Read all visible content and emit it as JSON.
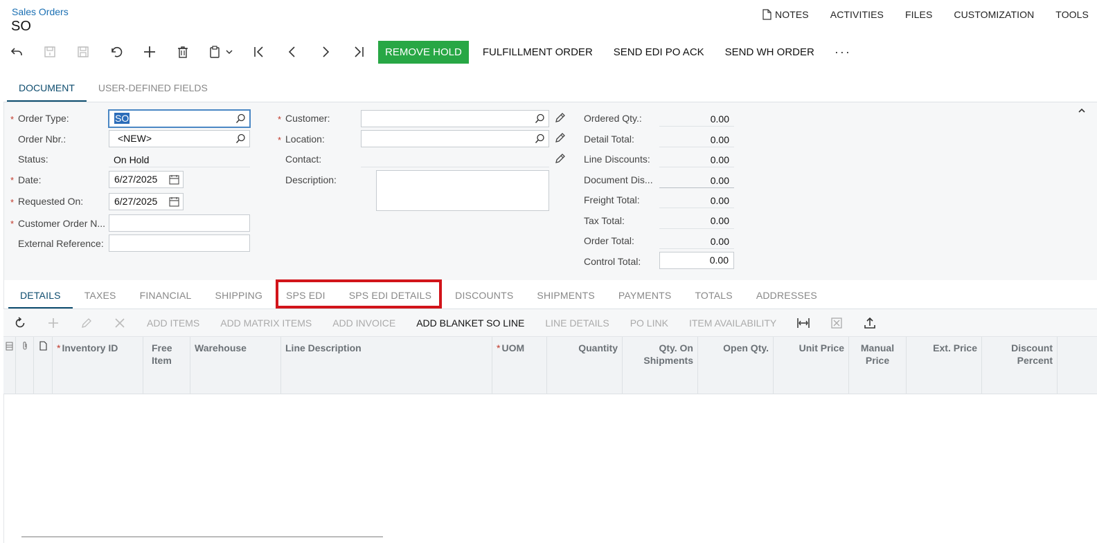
{
  "header": {
    "breadcrumb": "Sales Orders",
    "title": "SO",
    "links": [
      "NOTES",
      "ACTIVITIES",
      "FILES",
      "CUSTOMIZATION",
      "TOOLS"
    ]
  },
  "toolbar": {
    "remove_hold": "REMOVE HOLD",
    "fulfillment_order": "FULFILLMENT ORDER",
    "send_edi_po_ack": "SEND EDI PO ACK",
    "send_wh_order": "SEND WH ORDER",
    "more": "···"
  },
  "upper_tabs": [
    "DOCUMENT",
    "USER-DEFINED FIELDS"
  ],
  "form": {
    "order_type": {
      "label": "Order Type:",
      "value": "SO"
    },
    "order_nbr": {
      "label": "Order Nbr.:",
      "value": "<NEW>"
    },
    "status": {
      "label": "Status:",
      "value": "On Hold"
    },
    "date": {
      "label": "Date:",
      "value": "6/27/2025"
    },
    "requested_on": {
      "label": "Requested On:",
      "value": "6/27/2025"
    },
    "customer_order_nbr": {
      "label": "Customer Order N...",
      "value": ""
    },
    "external_reference": {
      "label": "External Reference:",
      "value": ""
    },
    "customer": {
      "label": "Customer:",
      "value": ""
    },
    "location": {
      "label": "Location:",
      "value": ""
    },
    "contact": {
      "label": "Contact:",
      "value": ""
    },
    "description": {
      "label": "Description:",
      "value": ""
    },
    "totals": [
      {
        "label": "Ordered Qty.:",
        "value": "0.00"
      },
      {
        "label": "Detail Total:",
        "value": "0.00"
      },
      {
        "label": "Line Discounts:",
        "value": "0.00"
      },
      {
        "label": "Document Dis...",
        "value": "0.00"
      },
      {
        "label": "Freight Total:",
        "value": "0.00"
      },
      {
        "label": "Tax Total:",
        "value": "0.00"
      },
      {
        "label": "Order Total:",
        "value": "0.00"
      },
      {
        "label": "Control Total:",
        "value": "0.00"
      }
    ]
  },
  "lower_tabs": [
    "DETAILS",
    "TAXES",
    "FINANCIAL",
    "SHIPPING",
    "SPS EDI",
    "SPS EDI DETAILS",
    "DISCOUNTS",
    "SHIPMENTS",
    "PAYMENTS",
    "TOTALS",
    "ADDRESSES"
  ],
  "grid_toolbar": {
    "add_items": "ADD ITEMS",
    "add_matrix_items": "ADD MATRIX ITEMS",
    "add_invoice": "ADD INVOICE",
    "add_blanket_so_line": "ADD BLANKET SO LINE",
    "line_details": "LINE DETAILS",
    "po_link": "PO LINK",
    "item_availability": "ITEM AVAILABILITY"
  },
  "grid_columns": {
    "inventory_id": "Inventory ID",
    "free_item_1": "Free",
    "free_item_2": "Item",
    "warehouse": "Warehouse",
    "line_description": "Line Description",
    "uom": "UOM",
    "quantity": "Quantity",
    "qty_on_shipments_1": "Qty. On",
    "qty_on_shipments_2": "Shipments",
    "open_qty": "Open Qty.",
    "unit_price": "Unit Price",
    "manual_price_1": "Manual",
    "manual_price_2": "Price",
    "ext_price": "Ext. Price",
    "discount_percent_1": "Discount",
    "discount_percent_2": "Percent"
  },
  "colors": {
    "accent": "#0d4c6e",
    "primary": "#28a745",
    "highlight": "#d2141a",
    "link": "#1a6fb3"
  }
}
